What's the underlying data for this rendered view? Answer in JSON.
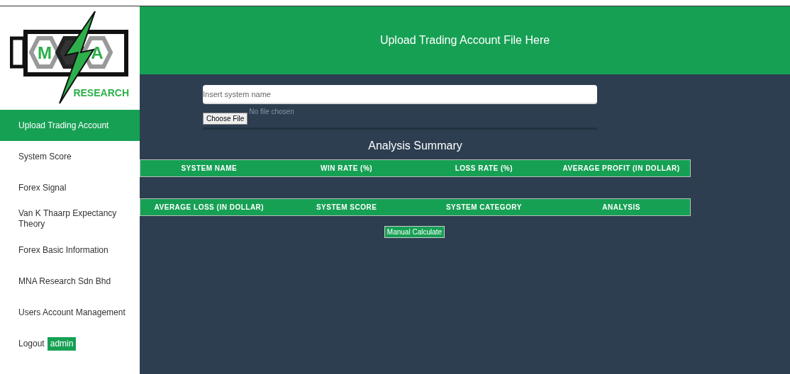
{
  "logo": {
    "letters": [
      "M",
      "A"
    ],
    "subtitle": "RESEARCH"
  },
  "sidebar": {
    "items": [
      {
        "label": "Upload Trading Account",
        "selected": true
      },
      {
        "label": "System Score",
        "selected": false
      },
      {
        "label": "Forex Signal",
        "selected": false
      },
      {
        "label": "Van K Thaarp Expectancy Theory",
        "selected": false
      },
      {
        "label": "Forex Basic Information",
        "selected": false
      },
      {
        "label": "MNA Research Sdn Bhd",
        "selected": false
      },
      {
        "label": "Users Account Management",
        "selected": false
      },
      {
        "label": "Logout",
        "selected": false,
        "badge": "admin"
      }
    ]
  },
  "header": {
    "title": "Upload Trading Account File Here"
  },
  "form": {
    "placeholder": "Insert system name",
    "file_button": "Choose File",
    "file_status": "No file chosen"
  },
  "summary": {
    "title": "Analysis Summary",
    "header_rows": [
      [
        "SYSTEM NAME",
        "WIN RATE (%)",
        "LOSS RATE (%)",
        "AVERAGE PROFIT (IN DOLLAR)"
      ],
      [
        "AVERAGE LOSS (IN DOLLAR)",
        "SYSTEM SCORE",
        "SYSTEM CATEGORY",
        "ANALYSIS"
      ]
    ],
    "button": "Manual Calculate"
  }
}
